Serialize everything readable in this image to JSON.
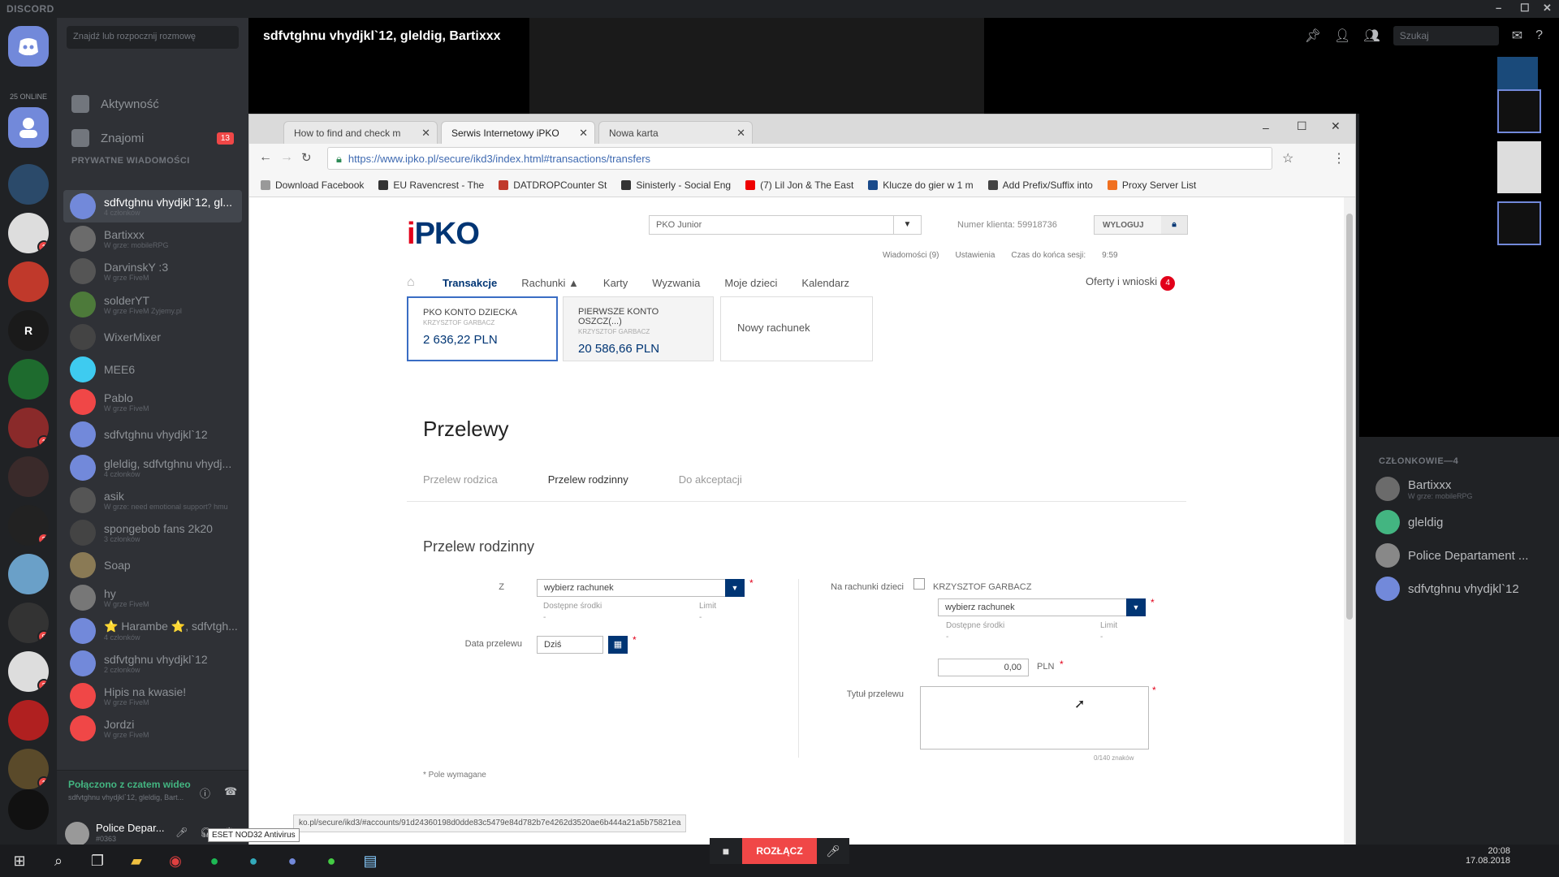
{
  "discord": {
    "brand": "DISCORD",
    "online_count": "25 ONLINE",
    "search_placeholder": "Znajdź lub rozpocznij rozmowę",
    "nav": [
      {
        "label": "Aktywność"
      },
      {
        "label": "Znajomi",
        "badge": "13"
      }
    ],
    "pm_header": "PRYWATNE WIADOMOŚCI",
    "dms": [
      {
        "name": "sdfvtghnu vhydjkl`12, gl...",
        "sub": "4 członków",
        "selected": true,
        "color": "#7289da"
      },
      {
        "name": "Bartixxx",
        "sub": "W grze: mobileRPG",
        "color": "#6b6b6b"
      },
      {
        "name": "DarvinskY :3",
        "sub": "W grze FiveM",
        "color": "#555"
      },
      {
        "name": "solderYT",
        "sub": "W grze FiveM Zyjemy.pl",
        "color": "#4d7a3a"
      },
      {
        "name": "WixerMixer",
        "sub": "",
        "color": "#444"
      },
      {
        "name": "MEE6",
        "sub": "",
        "color": "#3ecbf0"
      },
      {
        "name": "Pablo",
        "sub": "W grze FiveM",
        "color": "#f04747"
      },
      {
        "name": "sdfvtghnu vhydjkl`12",
        "sub": "",
        "color": "#7289da"
      },
      {
        "name": "gleldig, sdfvtghnu vhydj...",
        "sub": "4 członków",
        "color": "#7289da"
      },
      {
        "name": "asik",
        "sub": "W grze: need emotional support? hmu",
        "color": "#555"
      },
      {
        "name": "spongebob fans 2k20",
        "sub": "3 członków",
        "color": "#444"
      },
      {
        "name": "Soap",
        "sub": "",
        "color": "#8a7a55"
      },
      {
        "name": "hy",
        "sub": "W grze FiveM",
        "color": "#777"
      },
      {
        "name": "⭐ Harambe ⭐, sdfvtgh...",
        "sub": "4 członków",
        "color": "#7289da"
      },
      {
        "name": "sdfvtghnu vhydjkl`12",
        "sub": "2 członków",
        "color": "#7289da"
      },
      {
        "name": "Hipis na kwasie!",
        "sub": "W grze FiveM",
        "color": "#f04747"
      },
      {
        "name": "Jordzi",
        "sub": "W grze FiveM",
        "color": "#f04747"
      }
    ],
    "voice": {
      "status": "Połączono z czatem wideo",
      "sub": "sdfvtghnu vhydjkl`12, gleldig, Bart..."
    },
    "user": {
      "name": "Police Depar...",
      "tag": "#0363"
    },
    "call_title": "sdfvtghnu vhydjkl`12, gleldig, Bartixxx",
    "top_search": "Szukaj",
    "members_header": "CZŁONKOWIE—4",
    "members": [
      {
        "name": "Bartixxx",
        "sub": "W grze: mobileRPG",
        "color": "#6b6b6b"
      },
      {
        "name": "gleldig",
        "sub": "",
        "color": "#43b581"
      },
      {
        "name": "Police Departament ...",
        "sub": "",
        "color": "#888"
      },
      {
        "name": "sdfvtghnu vhydjkl`12",
        "sub": "",
        "color": "#7289da"
      }
    ],
    "call_controls": {
      "disconnect": "ROZŁĄCZ"
    },
    "guild_badges": [
      "1",
      "1",
      "2",
      "8",
      "2",
      "1"
    ]
  },
  "chrome": {
    "tabs": [
      {
        "label": "How to find and check m"
      },
      {
        "label": "Serwis Internetowy iPKO",
        "active": true
      },
      {
        "label": "Nowa karta"
      }
    ],
    "url": "https://www.ipko.pl/secure/ikd3/index.html#transactions/transfers",
    "bookmarks": [
      {
        "label": "Download Facebook",
        "color": "#999"
      },
      {
        "label": "EU Ravencrest - The",
        "color": "#333"
      },
      {
        "label": "DATDROPCounter St",
        "color": "#c0392b"
      },
      {
        "label": "Sinisterly - Social Eng",
        "color": "#333"
      },
      {
        "label": "(7) Lil Jon & The East",
        "color": "#e00"
      },
      {
        "label": "Klucze do gier w 1 m",
        "color": "#1a4a8a"
      },
      {
        "label": "Add Prefix/Suffix into",
        "color": "#444"
      },
      {
        "label": "Proxy Server List",
        "color": "#f07020"
      }
    ],
    "status_url": "ko.pl/secure/ikd3/#accounts/91d24360198d0dde83c5479e84d782b7e4262d3520ae6b444a21a5b75821ea"
  },
  "ipko": {
    "logo_i": "i",
    "logo_rest": "PKO",
    "account_select": "PKO Junior",
    "client_number": "Numer klienta: 59918736",
    "logout": "WYLOGUJ",
    "info": {
      "messages": "Wiadomości (9)",
      "settings": "Ustawienia",
      "session": "Czas do końca sesji:",
      "session_time": "9:59"
    },
    "nav": [
      "Transakcje",
      "Rachunki ▲",
      "Karty",
      "Wyzwania",
      "Moje dzieci",
      "Kalendarz"
    ],
    "offers": "Oferty i wnioski",
    "offers_badge": "4",
    "accounts": [
      {
        "title": "PKO KONTO DZIECKA",
        "owner": "KRZYSZTOF GARBACZ",
        "value": "2 636,22 PLN"
      },
      {
        "title": "PIERWSZE KONTO OSZCZ(...)",
        "owner": "KRZYSZTOF GARBACZ",
        "value": "20 586,66 PLN"
      }
    ],
    "new_account": "Nowy rachunek",
    "page_title": "Przelewy",
    "subtabs": [
      "Przelew rodzica",
      "Przelew rodzinny",
      "Do akceptacji"
    ],
    "form_title": "Przelew rodzinny",
    "form": {
      "from_label": "Z",
      "from_select": "wybierz rachunek",
      "available": "Dostępne środki",
      "limit": "Limit",
      "dash": "-",
      "date_label": "Data przelewu",
      "date_value": "Dziś",
      "to_label": "Na rachunki dzieci",
      "child_name": "KRZYSZTOF GARBACZ",
      "to_select": "wybierz rachunek",
      "amount": "0,00",
      "currency": "PLN",
      "title_label": "Tytuł przelewu",
      "char_count": "0/140 znaków",
      "required_note": "* Pole wymagane"
    }
  },
  "taskbar": {
    "time": "20:08",
    "date": "17.08.2018",
    "eset_tooltip": "ESET NOD32 Antivirus"
  }
}
